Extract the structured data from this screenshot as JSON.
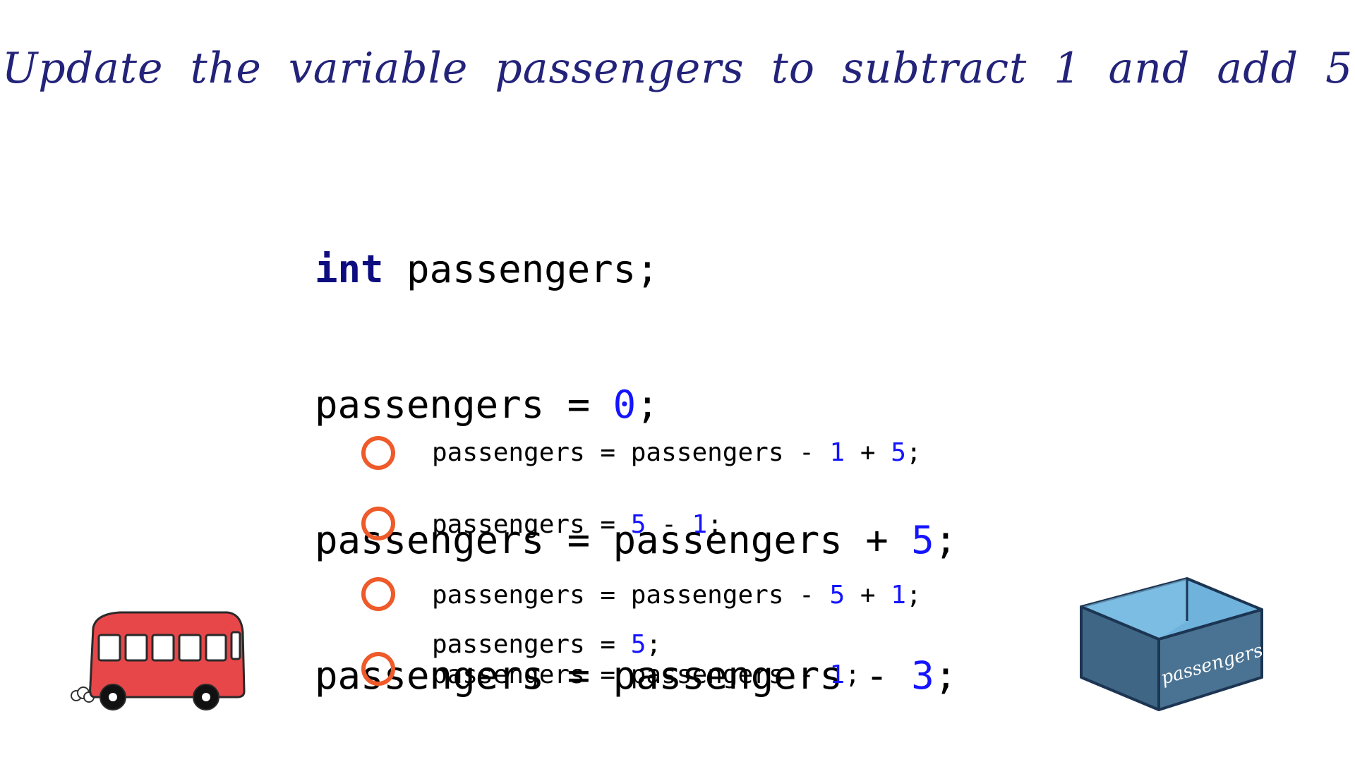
{
  "title": "Update the variable passengers to subtract 1 and add 5",
  "code": {
    "line1": {
      "keyword": "int",
      "rest": " passengers;"
    },
    "line2": {
      "pre": "passengers = ",
      "num": "0",
      "post": ";"
    },
    "line3": {
      "pre": "passengers = passengers + ",
      "num": "5",
      "post": ";"
    },
    "line4": {
      "pre": "passengers = passengers - ",
      "num": "3",
      "post": ";"
    }
  },
  "options": [
    {
      "parts": [
        "passengers = passengers - ",
        "1",
        " + ",
        "5",
        ";"
      ]
    },
    {
      "parts": [
        "passengers = ",
        "5",
        " - ",
        "1",
        ";"
      ]
    },
    {
      "parts": [
        "passengers = passengers - ",
        "5",
        " + ",
        "1",
        ";"
      ]
    },
    {
      "line1": [
        "passengers = ",
        "5",
        ";"
      ],
      "line2": [
        "passengers = passengers - ",
        "1",
        ";"
      ]
    }
  ],
  "box_label": "passengers",
  "colors": {
    "title": "#23237a",
    "keyword": "#0d0d80",
    "number": "#1414ff",
    "radio": "#ee5a2a",
    "bus": "#e8474a",
    "box": "#476f8c"
  },
  "icons": {
    "bus": "bus-icon",
    "box": "box-icon"
  }
}
